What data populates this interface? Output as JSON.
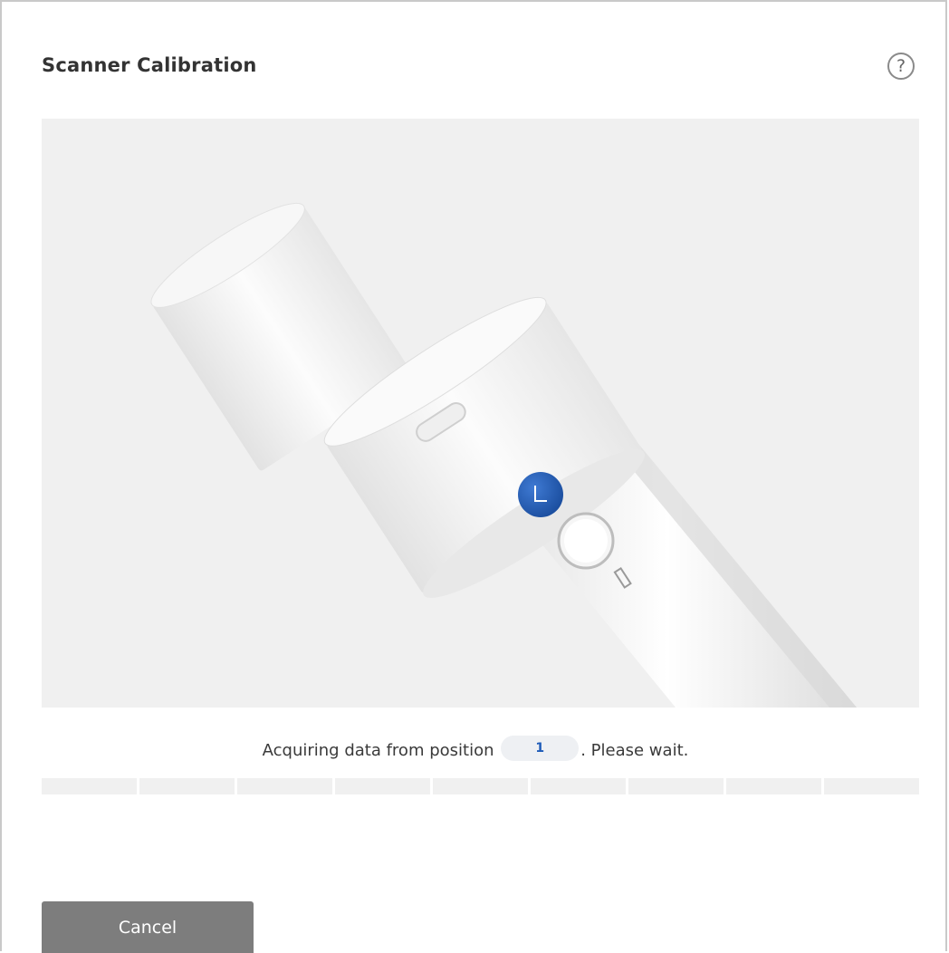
{
  "dialog": {
    "title": "Scanner Calibration",
    "help_icon": "question-mark-icon",
    "help_glyph": "?"
  },
  "status": {
    "prefix": "Acquiring data from position",
    "position": "1",
    "suffix": ". Please wait."
  },
  "progress": {
    "segments_total": 9,
    "segments_done": 0,
    "accent_color": "#2a67c6"
  },
  "actions": {
    "cancel_label": "Cancel"
  },
  "colors": {
    "background": "#ffffff",
    "illustration_bg": "#f0f0f0",
    "button_bg": "#7d7d7d",
    "accent_blue": "#1e5bb8"
  }
}
